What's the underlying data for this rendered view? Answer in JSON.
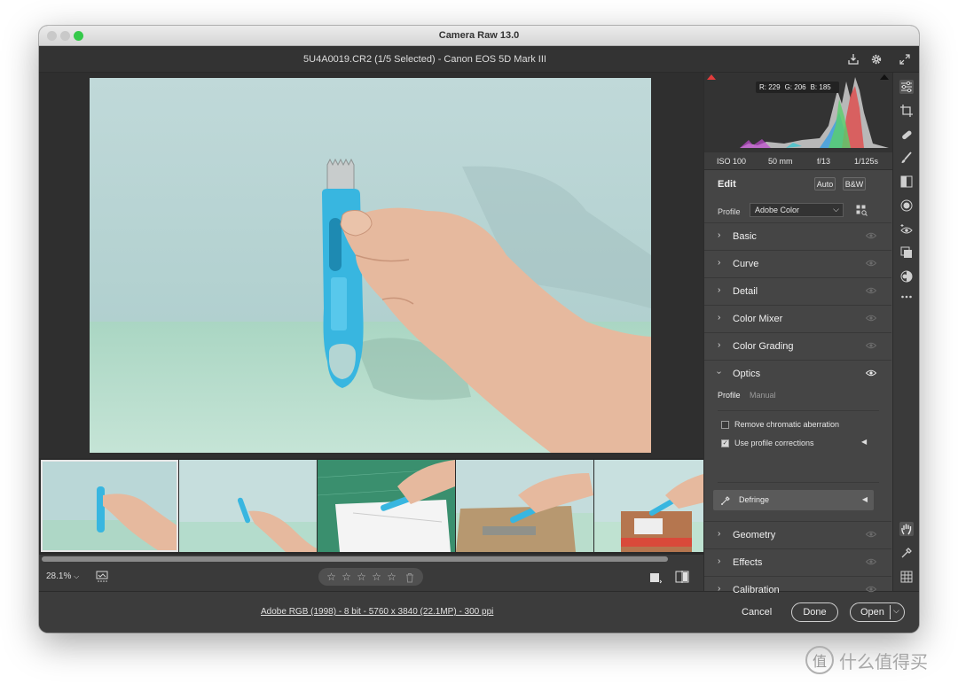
{
  "window": {
    "title": "Camera Raw 13.0"
  },
  "header": {
    "file_title": "5U4A0019.CR2 (1/5 Selected)  -  Canon EOS 5D Mark III"
  },
  "histogram": {
    "r": "R: 229",
    "g": "G: 206",
    "b": "B: 185"
  },
  "exif": {
    "iso": "ISO 100",
    "focal": "50 mm",
    "aperture": "f/13",
    "shutter": "1/125s"
  },
  "edit": {
    "title": "Edit",
    "auto_label": "Auto",
    "bw_label": "B&W",
    "profile_label": "Profile",
    "profile_value": "Adobe Color"
  },
  "sections": [
    {
      "label": "Basic"
    },
    {
      "label": "Curve"
    },
    {
      "label": "Detail"
    },
    {
      "label": "Color Mixer"
    },
    {
      "label": "Color Grading"
    },
    {
      "label": "Optics"
    },
    {
      "label": "Geometry"
    },
    {
      "label": "Effects"
    },
    {
      "label": "Calibration"
    }
  ],
  "optics": {
    "tab_profile": "Profile",
    "tab_manual": "Manual",
    "chromatic": {
      "label": "Remove chromatic aberration",
      "checked": false
    },
    "profile_corrections": {
      "label": "Use profile corrections",
      "checked": true
    },
    "defringe": "Defringe"
  },
  "bottombar": {
    "zoom": "28.1%",
    "stars": 5,
    "rating": 0
  },
  "footer": {
    "info": "Adobe RGB (1998) - 8 bit - 5760 x 3840 (22.1MP) - 300 ppi",
    "cancel": "Cancel",
    "done": "Done",
    "open": "Open"
  },
  "watermark": {
    "text": "什么值得买",
    "logo_char": "值"
  },
  "icons": {
    "header": [
      "save-icon",
      "gear-icon",
      "fullscreen-icon"
    ],
    "tools": [
      "edit-sliders-icon",
      "crop-icon",
      "healing-icon",
      "brush-icon",
      "linear-gradient-icon",
      "radial-filter-icon",
      "red-eye-icon",
      "snapshots-icon",
      "presets-icon",
      "more-icon",
      "hand-icon",
      "eyedropper-icon",
      "grid-icon"
    ]
  },
  "colors": {
    "accent_blue": "#38b6e0",
    "panel_bg": "#454545",
    "canvas_bg": "#2f2f2f"
  }
}
